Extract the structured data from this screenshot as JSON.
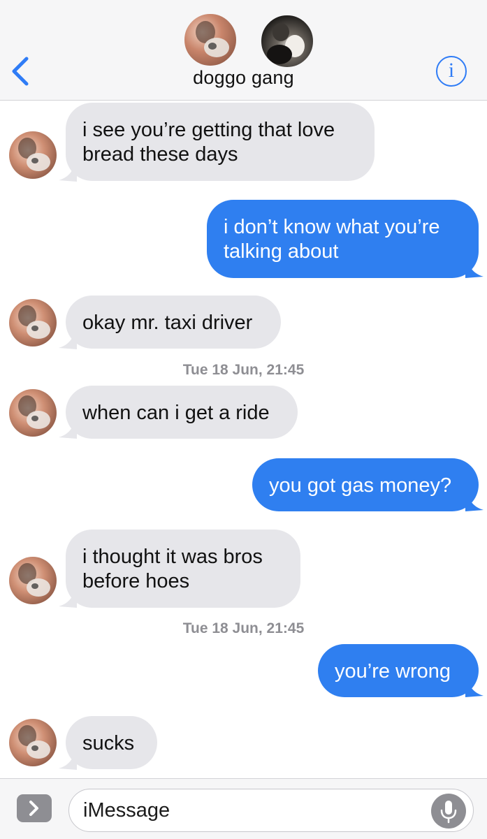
{
  "header": {
    "group_name": "doggo gang",
    "info_label": "i",
    "accent_color": "#2f7cf6"
  },
  "messages": [
    {
      "direction": "in",
      "text": "i see you’re getting that love\nbread these days"
    },
    {
      "direction": "out",
      "text": "i don’t know what you’re\ntalking about"
    },
    {
      "direction": "in",
      "text": "okay mr. taxi driver"
    },
    {
      "timestamp": "Tue 18 Jun, 21:45"
    },
    {
      "direction": "in",
      "text": "when can i get a ride"
    },
    {
      "direction": "out",
      "text": "you got gas money?"
    },
    {
      "direction": "in",
      "text": "i thought it was bros\nbefore hoes"
    },
    {
      "timestamp": "Tue 18 Jun, 21:45"
    },
    {
      "direction": "out",
      "text": "you’re wrong"
    },
    {
      "direction": "in",
      "text": "sucks"
    }
  ],
  "input": {
    "placeholder": "iMessage"
  },
  "icons": {
    "back": "chevron-left-icon",
    "info": "info-icon",
    "apps": "chevron-right-icon",
    "mic": "microphone-icon"
  },
  "colors": {
    "incoming_bubble": "#e6e6ea",
    "outgoing_bubble": "#2f7ff0"
  }
}
